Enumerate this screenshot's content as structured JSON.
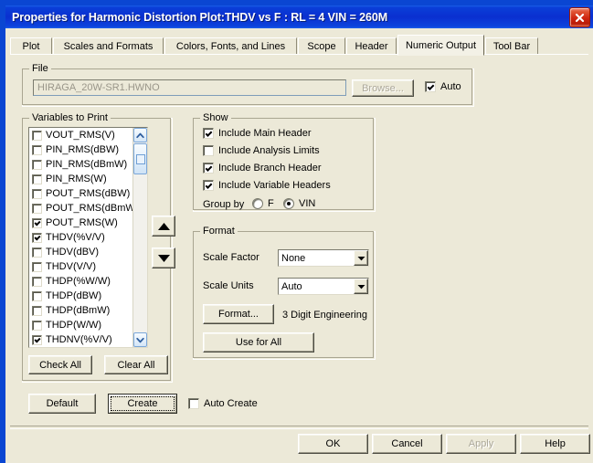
{
  "window": {
    "title": "Properties for Harmonic Distortion Plot:THDV vs F : RL = 4 VIN = 260M",
    "close_label": "×",
    "titlebar_color": "#0A2FD0",
    "face_color": "#ECE9D8"
  },
  "tabs": [
    {
      "label": "Plot",
      "active": false
    },
    {
      "label": "Scales and Formats",
      "active": false
    },
    {
      "label": "Colors, Fonts, and Lines",
      "active": false
    },
    {
      "label": "Scope",
      "active": false
    },
    {
      "label": "Header",
      "active": false
    },
    {
      "label": "Numeric Output",
      "active": true
    },
    {
      "label": "Tool Bar",
      "active": false
    }
  ],
  "file_group": {
    "legend": "File",
    "path_value": "HIRAGA_20W-SR1.HWNO",
    "browse_label": "Browse...",
    "auto_label": "Auto",
    "auto_checked": true,
    "browse_disabled": true,
    "path_disabled": true
  },
  "variables_group": {
    "legend": "Variables to Print",
    "items": [
      {
        "label": "VOUT_RMS(V)",
        "checked": false
      },
      {
        "label": "PIN_RMS(dBW)",
        "checked": false
      },
      {
        "label": "PIN_RMS(dBmW)",
        "checked": false
      },
      {
        "label": "PIN_RMS(W)",
        "checked": false
      },
      {
        "label": "POUT_RMS(dBW)",
        "checked": false
      },
      {
        "label": "POUT_RMS(dBmW)",
        "checked": false
      },
      {
        "label": "POUT_RMS(W)",
        "checked": true
      },
      {
        "label": "THDV(%V/V)",
        "checked": true
      },
      {
        "label": "THDV(dBV)",
        "checked": false
      },
      {
        "label": "THDV(V/V)",
        "checked": false
      },
      {
        "label": "THDP(%W/W)",
        "checked": false
      },
      {
        "label": "THDP(dBW)",
        "checked": false
      },
      {
        "label": "THDP(dBmW)",
        "checked": false
      },
      {
        "label": "THDP(W/W)",
        "checked": false
      },
      {
        "label": "THDNV(%V/V)",
        "checked": true
      }
    ],
    "check_all_label": "Check All",
    "clear_all_label": "Clear All",
    "scroll_up_icon": "chevron-up-icon",
    "scroll_down_icon": "chevron-down-icon",
    "move_up_icon": "triangle-up-icon",
    "move_down_icon": "triangle-down-icon"
  },
  "show_group": {
    "legend": "Show",
    "options": [
      {
        "label": "Include Main Header",
        "checked": true
      },
      {
        "label": "Include Analysis Limits",
        "checked": false
      },
      {
        "label": "Include Branch Header",
        "checked": true
      },
      {
        "label": "Include Variable Headers",
        "checked": true
      }
    ],
    "group_by_label": "Group by",
    "radios": [
      {
        "label": "F",
        "selected": false
      },
      {
        "label": "VIN",
        "selected": true
      }
    ]
  },
  "format_group": {
    "legend": "Format",
    "scale_factor_label": "Scale Factor",
    "scale_factor_value": "None",
    "scale_units_label": "Scale Units",
    "scale_units_value": "Auto",
    "format_button_label": "Format...",
    "format_status_text": "3 Digit Engineering",
    "use_for_all_label": "Use for All"
  },
  "actions": {
    "default_label": "Default",
    "create_label": "Create",
    "auto_create_label": "Auto Create",
    "auto_create_checked": false
  },
  "footer": {
    "ok_label": "OK",
    "cancel_label": "Cancel",
    "apply_label": "Apply",
    "apply_disabled": true,
    "help_label": "Help"
  }
}
